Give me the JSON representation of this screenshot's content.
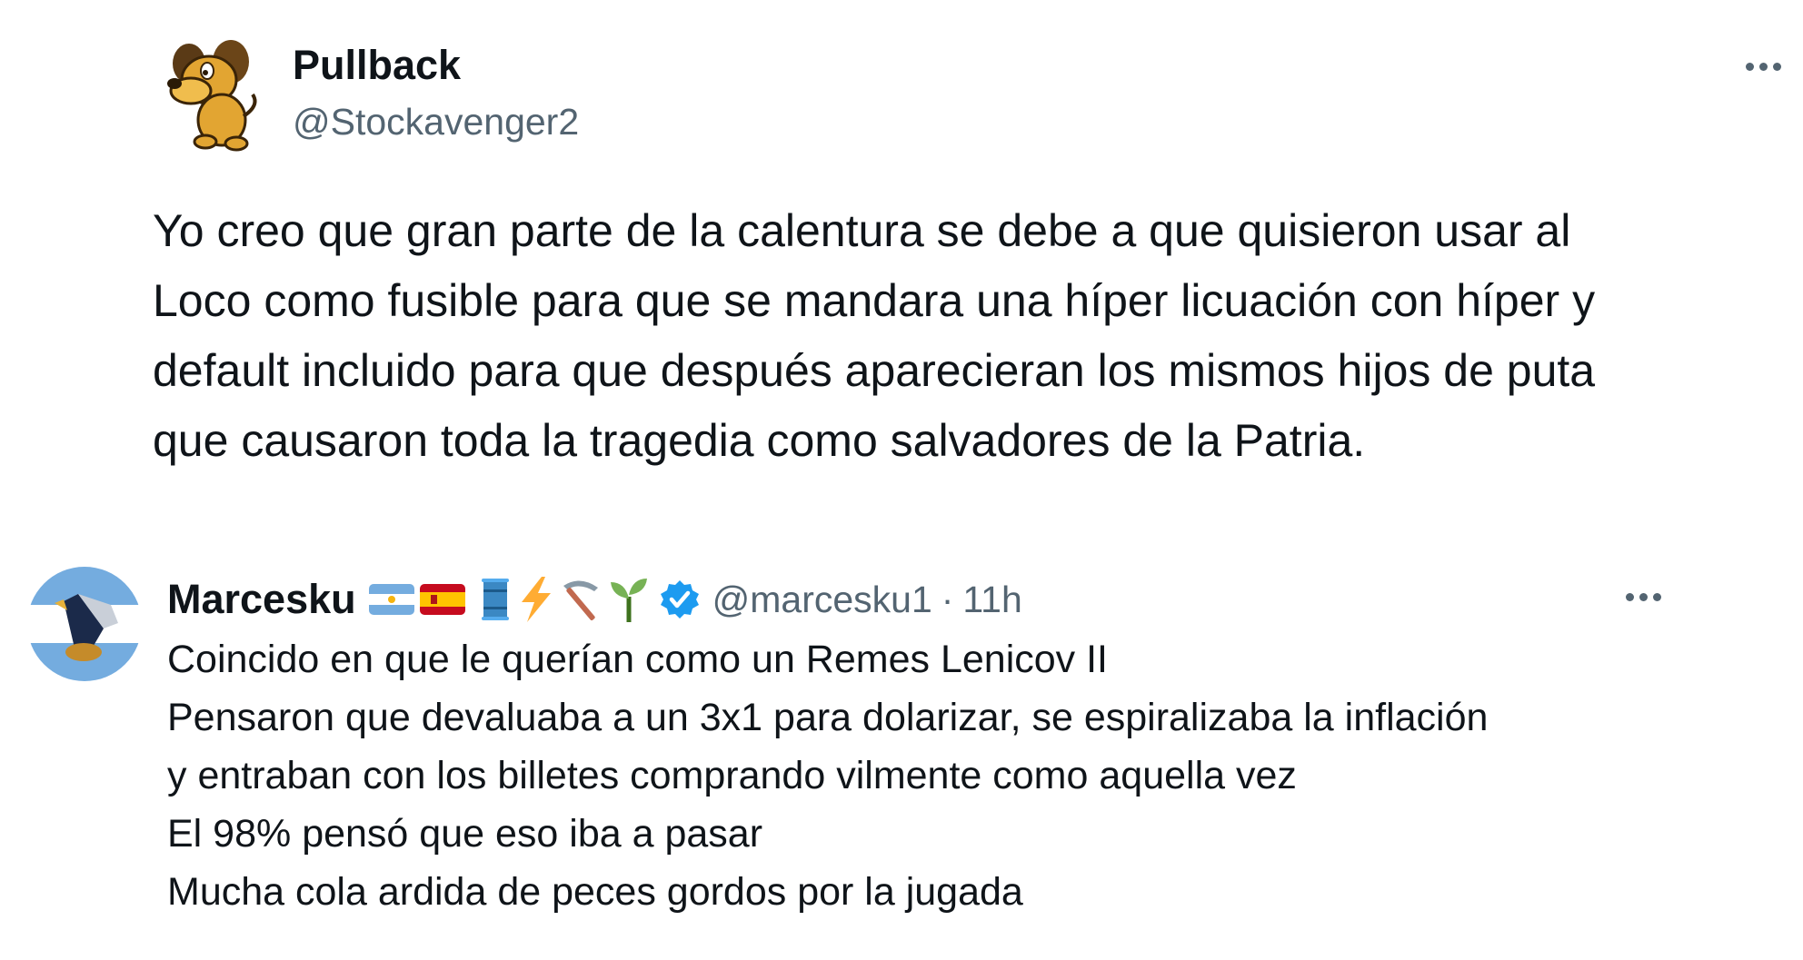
{
  "main_tweet": {
    "display_name": "Pullback",
    "handle": "@Stockavenger2",
    "avatar_icon": "cartoon-dog-icon",
    "more_icon": "more-options-icon",
    "text": "Yo creo que gran parte de la calentura se debe a que quisieron usar al\nLoco como fusible para que se mandara una híper licuación con híper y\ndefault incluido para que después aparecieran los mismos hijos de puta\nque causaron toda la tragedia como salvadores de la Patria."
  },
  "reply_tweet": {
    "display_name": "Marcesku",
    "name_emojis": [
      "argentina-flag-icon",
      "spain-flag-icon",
      "oil-drum-icon",
      "lightning-icon",
      "pickaxe-icon",
      "seedling-icon"
    ],
    "verified_icon": "verified-badge-icon",
    "handle": "@marcesku1",
    "separator": "·",
    "time": "11h",
    "more_icon": "more-options-icon",
    "text": "Coincido en que le querían como un Remes Lenicov II\nPensaron que devaluaba a un 3x1 para dolarizar, se espiralizaba la inflación\ny entraban con los billetes  comprando vilmente como aquella vez\nEl 98% pensó que eso iba a pasar\nMucha cola ardida de peces gordos por la jugada"
  },
  "colors": {
    "text_primary": "#0f1419",
    "text_secondary": "#536471",
    "verified_blue": "#1d9bf0"
  }
}
